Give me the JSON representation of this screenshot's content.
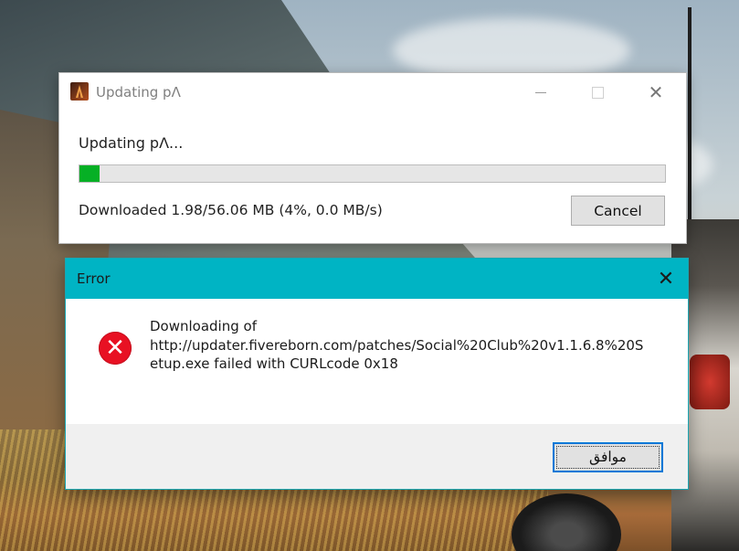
{
  "updater_window": {
    "title": "Updating pΛ",
    "status_label": "Updating pΛ...",
    "progress_fraction": 0.035,
    "downloaded_text": "Downloaded 1.98/56.06 MB (4%, 0.0 MB/s)",
    "cancel_label": "Cancel",
    "progress_color": "#06b025"
  },
  "error_dialog": {
    "title": "Error",
    "titlebar_color": "#00b4c4",
    "message_lines": [
      "Downloading of",
      "http://updater.fivereborn.com/patches/Social%20Club%20v1.1.6.8%20S",
      "etup.exe failed with CURLcode 0x18"
    ],
    "ok_label": "موافق"
  },
  "icons": {
    "app": "app-icon",
    "minimize": "minimize-icon",
    "maximize": "maximize-icon",
    "close": "close-icon",
    "error": "error-icon"
  }
}
